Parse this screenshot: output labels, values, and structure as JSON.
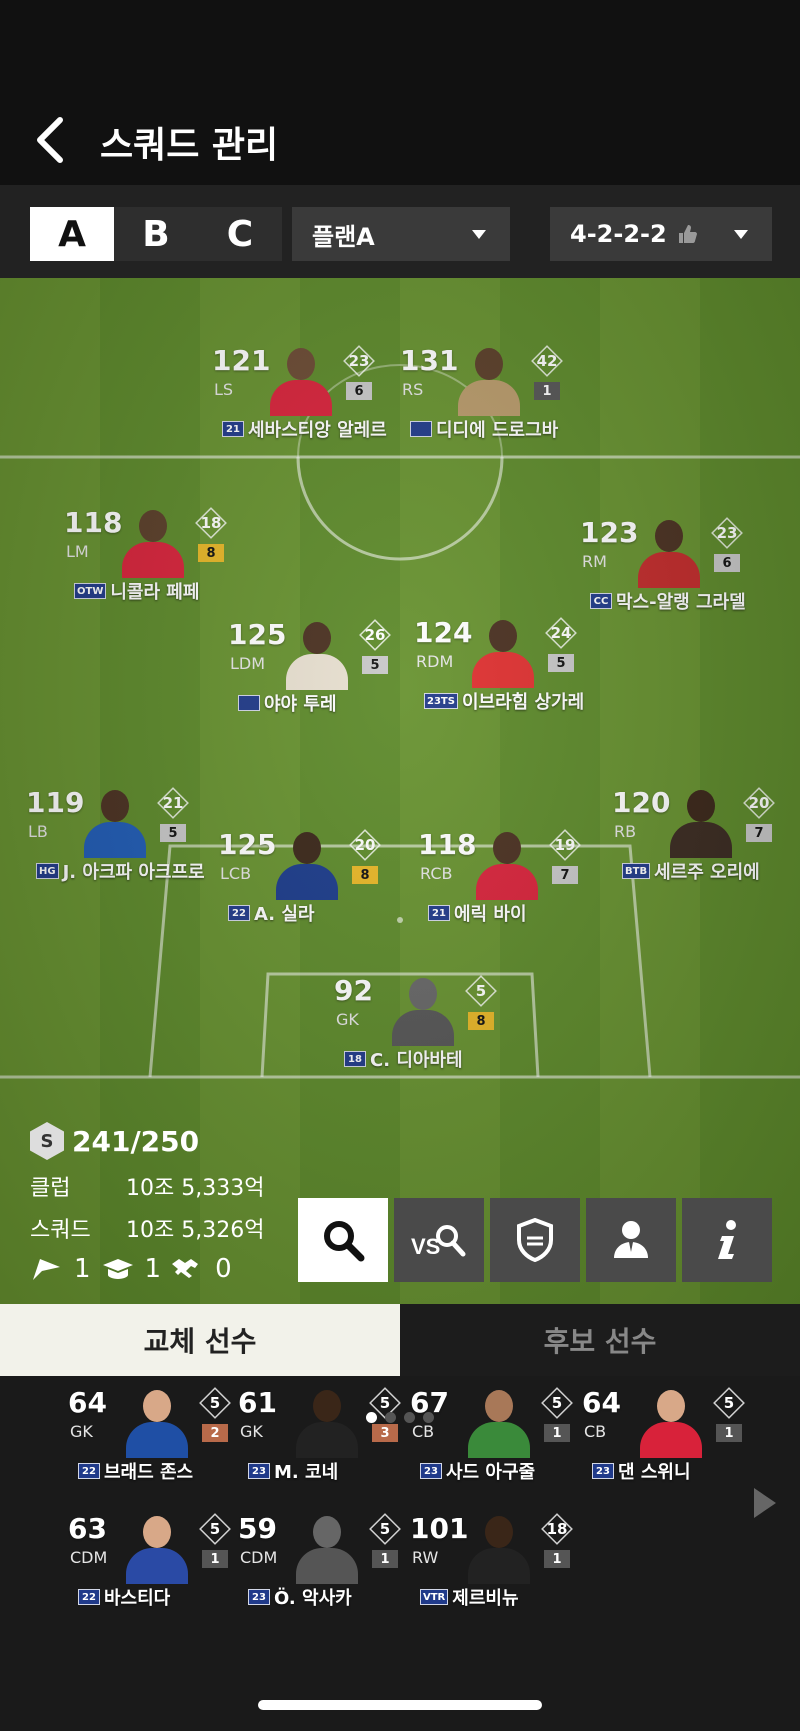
{
  "header": {
    "title": "스쿼드 관리"
  },
  "squad_tabs": [
    "A",
    "B",
    "C"
  ],
  "plan": {
    "label": "플랜A"
  },
  "formation": {
    "label": "4-2-2-2"
  },
  "players": [
    {
      "ovr": "121",
      "pos": "LS",
      "season": "23",
      "grade": "6",
      "badge": "21",
      "name": "세바스티앙 알레르",
      "kit": "#d8223a",
      "skin": "#6b4a33"
    },
    {
      "ovr": "131",
      "pos": "RS",
      "season": "42",
      "grade": "1",
      "badge": "",
      "name": "디디에 드로그바",
      "kit": "#b89a6a",
      "skin": "#5a3e28"
    },
    {
      "ovr": "118",
      "pos": "LM",
      "season": "18",
      "grade": "8",
      "badge": "OTW",
      "name": "니콜라 페페",
      "kit": "#d8223a",
      "skin": "#5a3e28"
    },
    {
      "ovr": "123",
      "pos": "RM",
      "season": "23",
      "grade": "6",
      "badge": "CC",
      "name": "막스-알랭 그라델",
      "kit": "#c22a2a",
      "skin": "#4a3020"
    },
    {
      "ovr": "125",
      "pos": "LDM",
      "season": "26",
      "grade": "5",
      "badge": "",
      "name": "야야 투레",
      "kit": "#e8e0d0",
      "skin": "#4a3020"
    },
    {
      "ovr": "124",
      "pos": "RDM",
      "season": "24",
      "grade": "5",
      "badge": "23TS",
      "name": "이브라힘 상가레",
      "kit": "#e03030",
      "skin": "#4a3020"
    },
    {
      "ovr": "119",
      "pos": "LB",
      "season": "21",
      "grade": "5",
      "badge": "HG",
      "name": "J. 아크파 아크프로",
      "kit": "#1f5bb5",
      "skin": "#4a3020"
    },
    {
      "ovr": "120",
      "pos": "RB",
      "season": "20",
      "grade": "7",
      "badge": "BTB",
      "name": "세르주 오리에",
      "kit": "#3a2a20",
      "skin": "#3a2618"
    },
    {
      "ovr": "125",
      "pos": "LCB",
      "season": "20",
      "grade": "8",
      "badge": "22",
      "name": "A. 실라",
      "kit": "#1a3a8a",
      "skin": "#3a2618"
    },
    {
      "ovr": "118",
      "pos": "RCB",
      "season": "19",
      "grade": "7",
      "badge": "21",
      "name": "에릭 바이",
      "kit": "#d8223a",
      "skin": "#4a3020"
    },
    {
      "ovr": "92",
      "pos": "GK",
      "season": "5",
      "grade": "8",
      "badge": "18",
      "name": "C. 디아바테",
      "kit": "#555",
      "skin": "#666"
    }
  ],
  "team_stats": {
    "salary": "241/250",
    "salary_icon": "S",
    "club_label": "클럽",
    "club_value": "10조 5,333억",
    "squad_label": "스쿼드",
    "squad_value": "10조 5,326억",
    "count_1": "1",
    "count_2": "1",
    "count_3": "0"
  },
  "action_buttons": [
    "search-icon",
    "versus-search-icon",
    "team-shield-icon",
    "manager-icon",
    "info-icon"
  ],
  "sub_tabs": {
    "active": "교체 선수",
    "inactive": "후보 선수"
  },
  "bench": [
    {
      "ovr": "64",
      "pos": "GK",
      "season": "5",
      "grade": "2",
      "badge": "22",
      "name": "브래드 존스",
      "kit": "#1f4fa5",
      "skin": "#d8a888"
    },
    {
      "ovr": "61",
      "pos": "GK",
      "season": "5",
      "grade": "3",
      "badge": "23",
      "name": "M. 코네",
      "kit": "#222",
      "skin": "#3a2618"
    },
    {
      "ovr": "67",
      "pos": "CB",
      "season": "5",
      "grade": "1",
      "badge": "23",
      "name": "사드 아구줄",
      "kit": "#3a8a3a",
      "skin": "#a87858"
    },
    {
      "ovr": "64",
      "pos": "CB",
      "season": "5",
      "grade": "1",
      "badge": "23",
      "name": "댄 스위니",
      "kit": "#d8223a",
      "skin": "#d8a888"
    },
    {
      "ovr": "63",
      "pos": "CDM",
      "season": "5",
      "grade": "1",
      "badge": "22",
      "name": "바스티다",
      "kit": "#2a4aa5",
      "skin": "#d8a888"
    },
    {
      "ovr": "59",
      "pos": "CDM",
      "season": "5",
      "grade": "1",
      "badge": "23",
      "name": "Ö. 악사카",
      "kit": "#555",
      "skin": "#666"
    },
    {
      "ovr": "101",
      "pos": "RW",
      "season": "18",
      "grade": "1",
      "badge": "VTR",
      "name": "제르비뉴",
      "kit": "#222",
      "skin": "#3a2618"
    }
  ],
  "colors": {
    "pitch_light": "#67922f",
    "pitch_dark": "#5d8a2a",
    "grade_gold": "#e8b726",
    "grade_silver": "#c8c8c8",
    "grade_bronze": "#b86a4a"
  }
}
